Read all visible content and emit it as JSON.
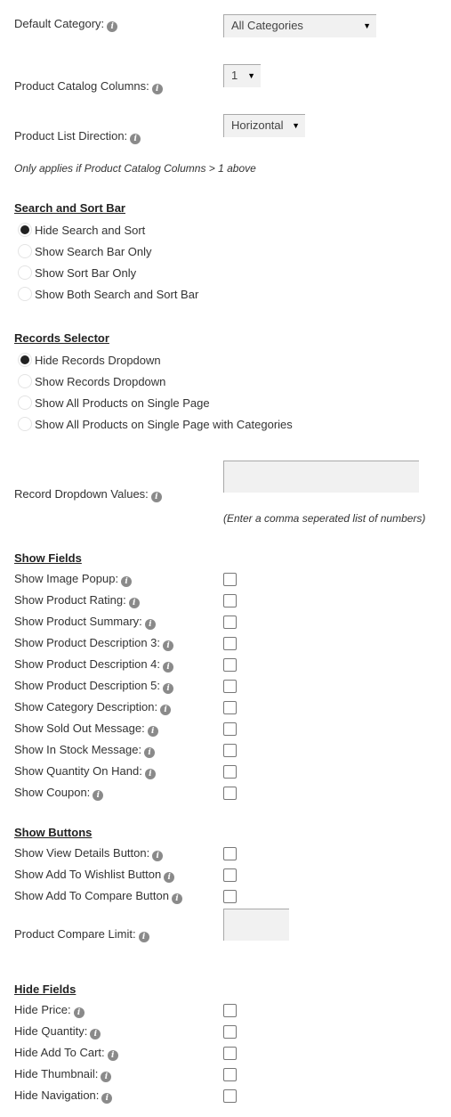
{
  "general": {
    "default_category": {
      "label": "Default Category:",
      "value": "All Categories"
    },
    "catalog_columns": {
      "label": "Product Catalog Columns:",
      "value": "1"
    },
    "list_direction": {
      "label": "Product List Direction:",
      "value": "Horizontal"
    },
    "columns_note": "Only applies if Product Catalog Columns > 1 above"
  },
  "search_sort": {
    "heading": "Search and Sort Bar",
    "options": [
      {
        "label": "Hide Search and Sort",
        "checked": true
      },
      {
        "label": "Show Search Bar Only",
        "checked": false
      },
      {
        "label": "Show Sort Bar Only",
        "checked": false
      },
      {
        "label": "Show Both Search and Sort Bar",
        "checked": false
      }
    ]
  },
  "records_selector": {
    "heading": "Records Selector",
    "options": [
      {
        "label": "Hide Records Dropdown",
        "checked": true
      },
      {
        "label": "Show Records Dropdown",
        "checked": false
      },
      {
        "label": "Show All Products on Single Page",
        "checked": false
      },
      {
        "label": "Show All Products on Single Page with Categories",
        "checked": false
      }
    ],
    "dropdown_values": {
      "label": "Record Dropdown Values:",
      "value": "",
      "note": "(Enter a comma seperated list of numbers)"
    }
  },
  "show_fields": {
    "heading": "Show Fields",
    "items": [
      {
        "label": "Show Image Popup:",
        "checked": false
      },
      {
        "label": "Show Product Rating:",
        "checked": false
      },
      {
        "label": "Show Product Summary:",
        "checked": false
      },
      {
        "label": "Show Product Description 3:",
        "checked": false
      },
      {
        "label": "Show Product Description 4:",
        "checked": false
      },
      {
        "label": "Show Product Description 5:",
        "checked": false
      },
      {
        "label": "Show Category Description:",
        "checked": false
      },
      {
        "label": "Show Sold Out Message:",
        "checked": false
      },
      {
        "label": "Show In Stock Message:",
        "checked": false
      },
      {
        "label": "Show Quantity On Hand:",
        "checked": false
      },
      {
        "label": "Show Coupon:",
        "checked": false
      }
    ]
  },
  "show_buttons": {
    "heading": "Show Buttons",
    "items": [
      {
        "label": "Show View Details Button:",
        "checked": false
      },
      {
        "label": "Show Add To Wishlist Button",
        "checked": false
      },
      {
        "label": "Show Add To Compare Button",
        "checked": false
      }
    ],
    "compare_limit": {
      "label": "Product Compare Limit:",
      "value": ""
    }
  },
  "hide_fields": {
    "heading": "Hide Fields",
    "items": [
      {
        "label": "Hide Price:",
        "checked": false
      },
      {
        "label": "Hide Quantity:",
        "checked": false
      },
      {
        "label": "Hide Add To Cart:",
        "checked": false
      },
      {
        "label": "Hide Thumbnail:",
        "checked": false
      },
      {
        "label": "Hide Navigation:",
        "checked": false
      }
    ]
  },
  "icons": {
    "info": "info-icon",
    "dropdown_arrow": "▼",
    "info_glyph": "i"
  }
}
